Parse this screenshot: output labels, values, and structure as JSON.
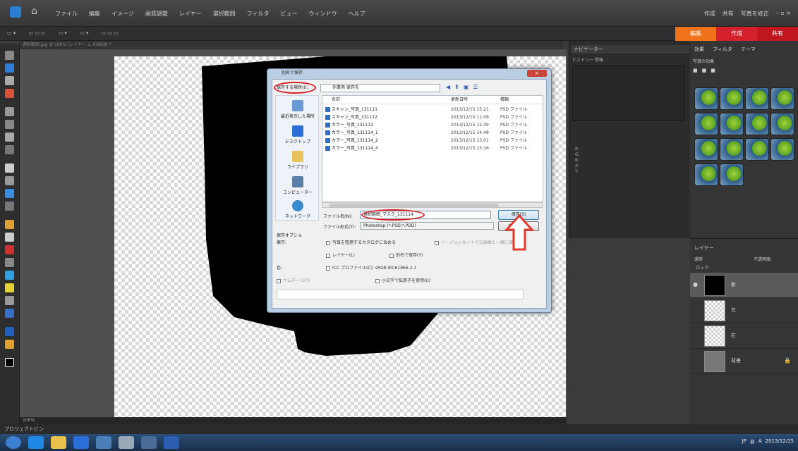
{
  "menubar": {
    "items": [
      "ファイル",
      "編集",
      "イメージ",
      "画質調整",
      "レイヤー",
      "選択範囲",
      "フィルタ",
      "ビュー",
      "ウィンドウ",
      "ヘルプ"
    ],
    "right_items": [
      "作成",
      "共有",
      "写真を修正"
    ]
  },
  "modetabs": [
    "編集",
    "作成",
    "共有"
  ],
  "document_tab": "選択範囲.jpg @ 100% (レイヤー 1, RGB/8) *",
  "statusbar": "100%",
  "project_bin": "プロジェクトビン",
  "navigator": {
    "title": "ナビゲーター",
    "tabs": "ヒストリー  情報",
    "info": [
      "R:",
      "G:",
      "B:",
      "X:",
      "Y:",
      "W:",
      "H:"
    ]
  },
  "effects": {
    "tabs": [
      "効果",
      "フィルタ",
      "テーマ"
    ],
    "sub": "写真の効果"
  },
  "layers": {
    "title": "レイヤー",
    "blend": "通常",
    "opacity_label": "不透明度:",
    "lock_label": "ロック:",
    "rows": [
      {
        "name": "影"
      },
      {
        "name": "左"
      },
      {
        "name": "右"
      },
      {
        "name": "背景"
      }
    ]
  },
  "dialog": {
    "title": "別名で保存",
    "close": "×",
    "look_in_label": "保存する場所(I):",
    "path": "作業用 保存先",
    "places": [
      "最近表示した場所",
      "デスクトップ",
      "ライブラリ",
      "コンピューター",
      "ネットワーク"
    ],
    "columns": [
      "名前",
      "更新日時",
      "種類"
    ],
    "files": [
      {
        "name": "スキャン_写真_131111",
        "date": "2013/12/15 15:21",
        "type": "PSD ファイル"
      },
      {
        "name": "スキャン_写真_131112",
        "date": "2013/12/15 11:09",
        "type": "PSD ファイル"
      },
      {
        "name": "カラー_写真_131113",
        "date": "2013/12/15 12:39",
        "type": "PSD ファイル"
      },
      {
        "name": "カラー_写真_131114_1",
        "date": "2013/12/15 14:48",
        "type": "PSD ファイル"
      },
      {
        "name": "カラー_写真_131114_2",
        "date": "2013/12/15 13:01",
        "type": "PSD ファイル"
      },
      {
        "name": "カラー_写真_131114_4",
        "date": "2013/12/15 15:16",
        "type": "PSD ファイル"
      }
    ],
    "filename_label": "ファイル名(N):",
    "filename_value": "選択範囲_マスク_131114",
    "filetype_label": "ファイル形式(T):",
    "filetype_value": "Photoshop (*.PSD;*.PDD)",
    "save_button": "保存(S)",
    "cancel_button": "キャンセル",
    "options_heading": "保存オプション",
    "opt_labels": [
      "保存:",
      "色:",
      "サムネール:"
    ],
    "opt1": "写真を整理するカタログに含める",
    "opt1b": "バージョンセットで元画像と一緒に保存",
    "opt2": "レイヤー(L)",
    "opt2b": "別名で保存(Y)",
    "opt3": "ICC プロファイル(C): sRGB IEC61966-2.1",
    "opt4": "サムネール(T)",
    "opt4b": "小文字で拡張子を使用(U)"
  },
  "taskbar": {
    "tray": [
      "JP",
      "あ",
      "A",
      "2013/12/15"
    ]
  },
  "colors": {
    "accent_orange": "#f0731c",
    "tab_red": "#d4202a",
    "arrow_red": "#e03a2e"
  }
}
